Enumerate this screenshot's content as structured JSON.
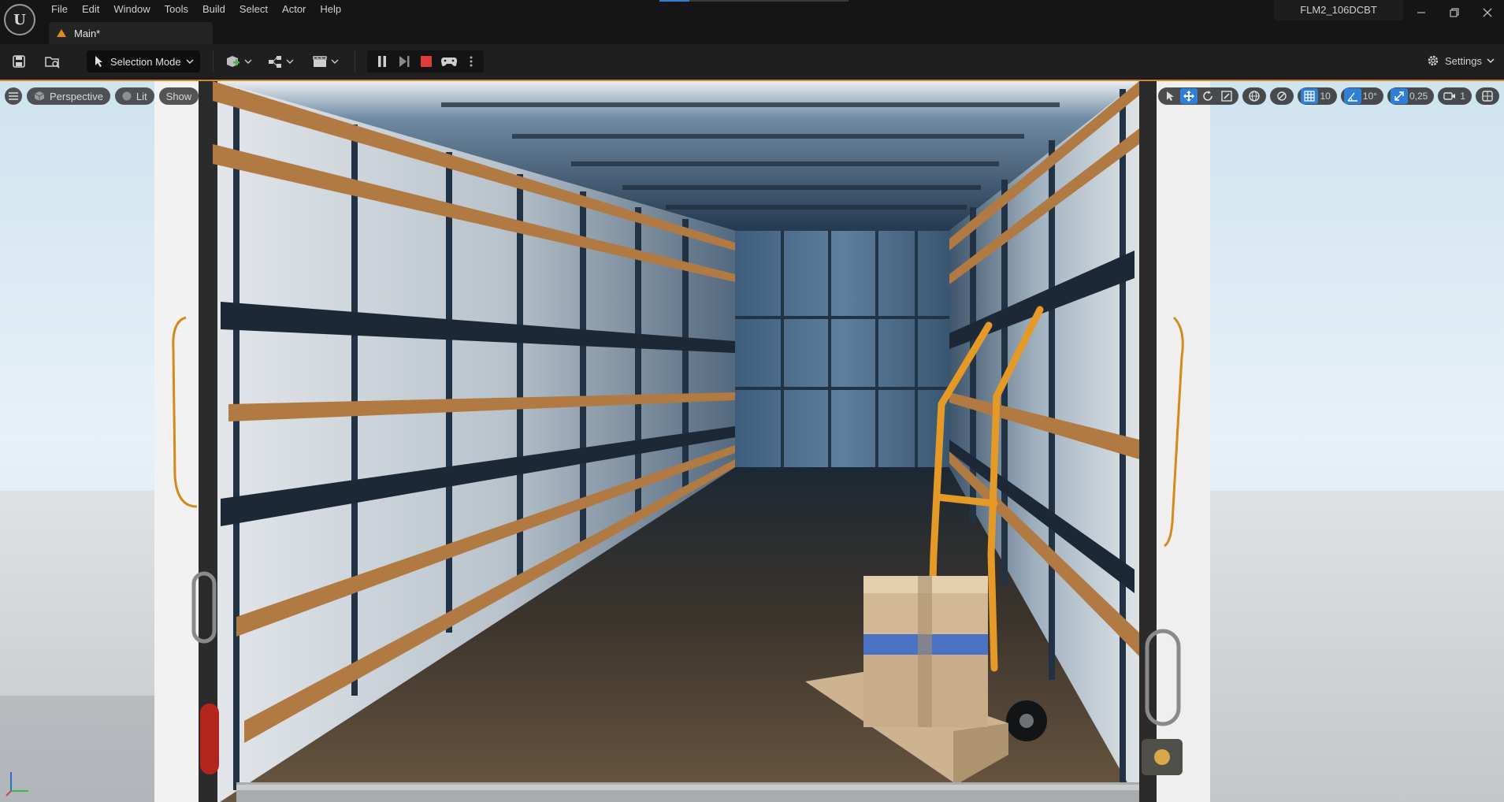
{
  "app": {
    "logo_icon": "unreal-engine-logo-icon",
    "project_name": "FLM2_106DCBT",
    "progress": 0.16
  },
  "menu": [
    "File",
    "Edit",
    "Window",
    "Tools",
    "Build",
    "Select",
    "Actor",
    "Help"
  ],
  "document_tab": {
    "label": "Main*",
    "icon": "level-icon"
  },
  "window_controls": [
    "minimize-icon",
    "restore-icon",
    "close-icon"
  ],
  "toolbar": {
    "selection_mode_label": "Selection Mode",
    "settings_label": "Settings"
  },
  "viewport": {
    "view_mode": "Perspective",
    "lighting": "Lit",
    "show_label": "Show",
    "grid_snap": "10",
    "rotation_snap": "10°",
    "scale_snap": "0,25",
    "camera_speed": "1"
  },
  "colors": {
    "selection_outline": "#d48a1a",
    "accent_blue": "#2f7fd6",
    "stop_red": "#e03b3b"
  }
}
